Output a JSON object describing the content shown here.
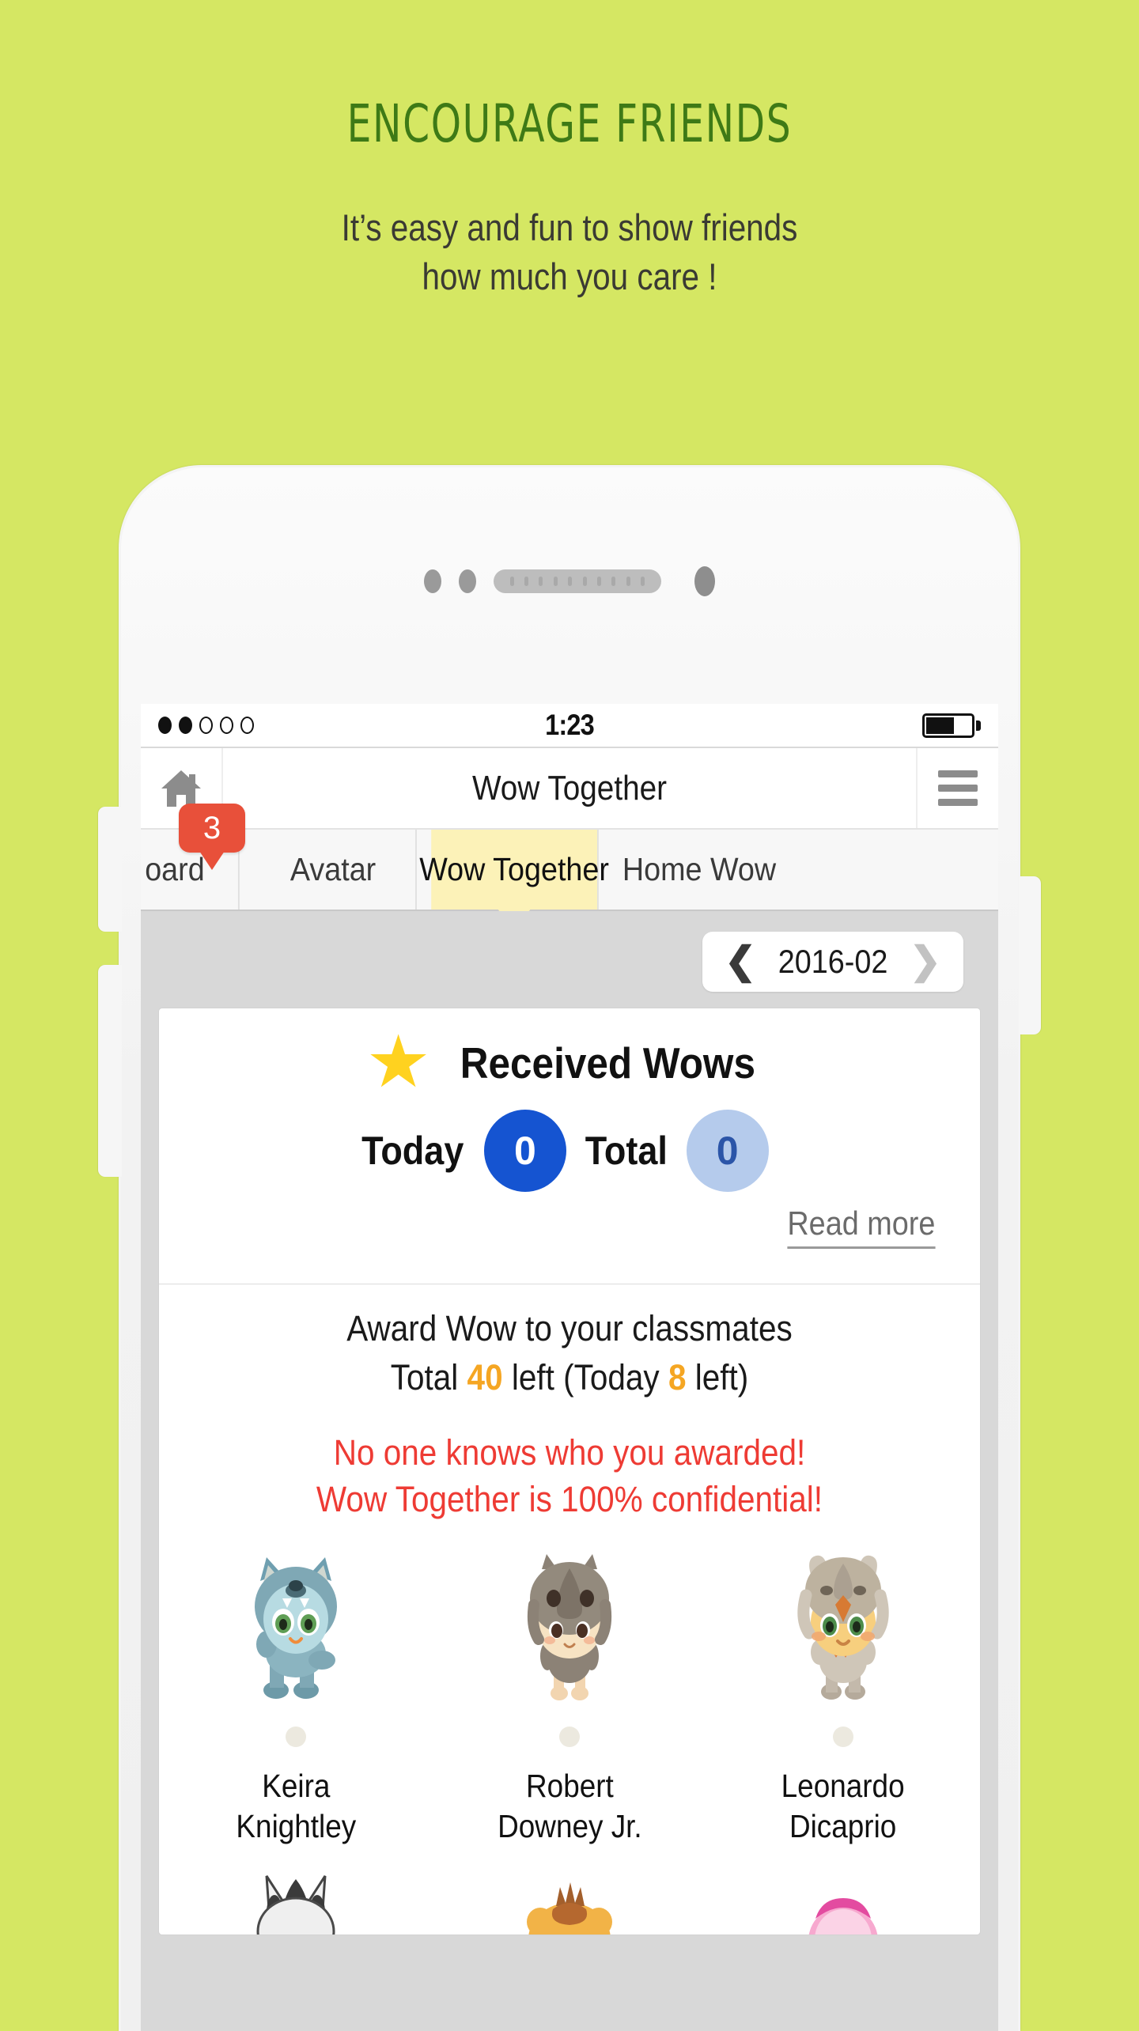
{
  "promo": {
    "title": "ENCOURAGE FRIENDS",
    "subtitle_line1": "It’s easy and fun to show friends",
    "subtitle_line2": "how much you care !"
  },
  "colors": {
    "background_green": "#d5e763",
    "title_green": "#3e7a16",
    "active_tab_yellow": "#fcf2b8",
    "badge_red": "#e8503a",
    "today_blue": "#1554d1",
    "total_blue": "#b5cbec",
    "star_yellow": "#ffd21f",
    "warning_red": "#ee3b34",
    "count_orange": "#f5a623"
  },
  "statusbar": {
    "signal_filled": 2,
    "signal_total": 5,
    "time": "1:23",
    "battery_percent": 62
  },
  "navbar": {
    "home_icon": "home-icon",
    "title": "Wow Together",
    "menu_icon": "hamburger-menu-icon",
    "badge_count": "3"
  },
  "tabs": [
    {
      "label": "oard",
      "active": false,
      "truncated": true
    },
    {
      "label": "Avatar",
      "active": false
    },
    {
      "label": "Wow Together",
      "active": true
    },
    {
      "label": "Home Wow",
      "active": false
    }
  ],
  "date_nav": {
    "prev_icon": "chevron-left-icon",
    "value": "2016-02",
    "next_icon": "chevron-right-icon",
    "next_disabled": true
  },
  "received_wows": {
    "star_icon": "star-icon",
    "title": "Received Wows",
    "today_label": "Today",
    "today_value": "0",
    "total_label": "Total",
    "total_value": "0",
    "read_more": "Read more"
  },
  "award": {
    "line1": "Award Wow to your classmates",
    "total_prefix": "Total ",
    "total_count": "40",
    "total_mid": " left (Today ",
    "today_count": "8",
    "total_suffix": " left)",
    "confidential_line1": "No one knows who you awarded!",
    "confidential_line2": "Wow Together is 100% confidential!"
  },
  "classmates": [
    {
      "name_line1": "Keira",
      "name_line2": "Knightley",
      "avatar": "blue-wolf-avatar",
      "selected": false
    },
    {
      "name_line1": "Robert",
      "name_line2": "Downey Jr.",
      "avatar": "gray-rhino-avatar",
      "selected": false
    },
    {
      "name_line1": "Leonardo",
      "name_line2": "Dicaprio",
      "avatar": "tan-owl-avatar",
      "selected": false
    }
  ],
  "classmates_row2": [
    {
      "avatar": "zebra-avatar"
    },
    {
      "avatar": "lion-avatar"
    },
    {
      "avatar": "pink-avatar"
    }
  ]
}
